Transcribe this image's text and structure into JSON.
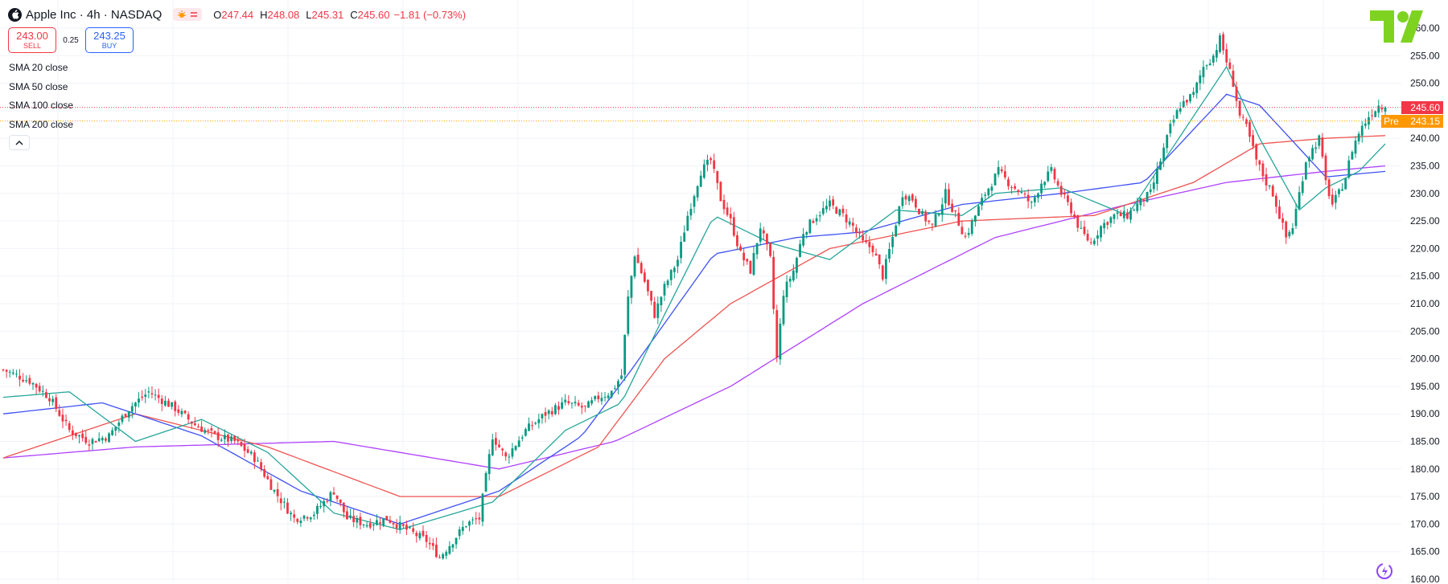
{
  "header": {
    "symbol_title": "Apple Inc · 4h · NASDAQ",
    "ohlc": {
      "open_label": "O",
      "open": "247.44",
      "high_label": "H",
      "high": "248.08",
      "low_label": "L",
      "low": "245.31",
      "close_label": "C",
      "close": "245.60",
      "change": "−1.81 (−0.73%)"
    },
    "colors": {
      "down": "#f23645",
      "up": "#089981"
    }
  },
  "trade": {
    "sell_price": "243.00",
    "sell_label": "SELL",
    "spread": "0.25",
    "buy_price": "243.25",
    "buy_label": "BUY"
  },
  "indicators": [
    "SMA 20 close",
    "SMA 50 close",
    "SMA 100 close",
    "SMA 200 close"
  ],
  "price_tags": {
    "last": "245.60",
    "pre_label": "Pre",
    "pre": "243.15"
  },
  "icons": [
    "apple-logo-icon",
    "sun-icon",
    "equals-icon",
    "chevron-up-icon",
    "tradingview-logo-icon",
    "assistant-icon"
  ],
  "chart_data": {
    "type": "candlestick",
    "ylim": [
      160,
      260
    ],
    "y_ticks": [
      "160.00",
      "165.00",
      "170.00",
      "175.00",
      "180.00",
      "185.00",
      "190.00",
      "195.00",
      "200.00",
      "205.00",
      "210.00",
      "215.00",
      "220.00",
      "225.00",
      "230.00",
      "235.00",
      "240.00",
      "245.00",
      "250.00",
      "255.00",
      "260.00"
    ],
    "grid": true,
    "series_colors": {
      "sma20": "#26a69a",
      "sma50": "#3f51f5",
      "sma100": "#ef5350",
      "sma200": "#b040ff"
    },
    "last_price": 245.6,
    "pre_price": 243.15,
    "close_path": [
      [
        0,
        198
      ],
      [
        8,
        196
      ],
      [
        14,
        193
      ],
      [
        20,
        187
      ],
      [
        26,
        185
      ],
      [
        32,
        186
      ],
      [
        38,
        191
      ],
      [
        44,
        194
      ],
      [
        52,
        191
      ],
      [
        58,
        188
      ],
      [
        64,
        186
      ],
      [
        70,
        185
      ],
      [
        76,
        182
      ],
      [
        82,
        176
      ],
      [
        88,
        171
      ],
      [
        94,
        172
      ],
      [
        100,
        176
      ],
      [
        104,
        171
      ],
      [
        110,
        170
      ],
      [
        116,
        171
      ],
      [
        122,
        169
      ],
      [
        128,
        167
      ],
      [
        132,
        164
      ],
      [
        136,
        167
      ],
      [
        140,
        170
      ],
      [
        144,
        171
      ],
      [
        148,
        186
      ],
      [
        152,
        182
      ],
      [
        158,
        187
      ],
      [
        164,
        190
      ],
      [
        170,
        192
      ],
      [
        176,
        191
      ],
      [
        180,
        193
      ],
      [
        184,
        194
      ],
      [
        187,
        197
      ],
      [
        189,
        211
      ],
      [
        191,
        219
      ],
      [
        194,
        214
      ],
      [
        197,
        208
      ],
      [
        200,
        213
      ],
      [
        204,
        218
      ],
      [
        207,
        226
      ],
      [
        211,
        234
      ],
      [
        214,
        236
      ],
      [
        217,
        229
      ],
      [
        220,
        225
      ],
      [
        223,
        219
      ],
      [
        226,
        216
      ],
      [
        229,
        224
      ],
      [
        232,
        218
      ],
      [
        234,
        200
      ],
      [
        236,
        212
      ],
      [
        239,
        216
      ],
      [
        242,
        223
      ],
      [
        246,
        226
      ],
      [
        250,
        228
      ],
      [
        254,
        226
      ],
      [
        257,
        224
      ],
      [
        260,
        221
      ],
      [
        263,
        220
      ],
      [
        266,
        215
      ],
      [
        269,
        222
      ],
      [
        272,
        230
      ],
      [
        275,
        229
      ],
      [
        278,
        226
      ],
      [
        281,
        224
      ],
      [
        285,
        230
      ],
      [
        288,
        226
      ],
      [
        291,
        222
      ],
      [
        294,
        226
      ],
      [
        297,
        230
      ],
      [
        301,
        234
      ],
      [
        304,
        232
      ],
      [
        308,
        230
      ],
      [
        311,
        228
      ],
      [
        314,
        232
      ],
      [
        317,
        234
      ],
      [
        320,
        230
      ],
      [
        323,
        227
      ],
      [
        326,
        223
      ],
      [
        329,
        221
      ],
      [
        332,
        224
      ],
      [
        336,
        226
      ],
      [
        340,
        226
      ],
      [
        343,
        228
      ],
      [
        347,
        230
      ],
      [
        350,
        236
      ],
      [
        353,
        242
      ],
      [
        356,
        246
      ],
      [
        360,
        248
      ],
      [
        363,
        253
      ],
      [
        366,
        255
      ],
      [
        368,
        258
      ],
      [
        370,
        254
      ],
      [
        372,
        250
      ],
      [
        374,
        244
      ],
      [
        376,
        242
      ],
      [
        379,
        236
      ],
      [
        382,
        232
      ],
      [
        384,
        230
      ],
      [
        386,
        226
      ],
      [
        388,
        222
      ],
      [
        390,
        224
      ],
      [
        392,
        230
      ],
      [
        394,
        236
      ],
      [
        396,
        238
      ],
      [
        398,
        240
      ],
      [
        400,
        232
      ],
      [
        402,
        228
      ],
      [
        404,
        230
      ],
      [
        406,
        233
      ],
      [
        408,
        238
      ],
      [
        410,
        241
      ],
      [
        413,
        244
      ],
      [
        416,
        246
      ],
      [
        418,
        245.6
      ]
    ],
    "sma20_path": [
      [
        0,
        193
      ],
      [
        20,
        194
      ],
      [
        40,
        185
      ],
      [
        60,
        189
      ],
      [
        80,
        183
      ],
      [
        100,
        172
      ],
      [
        120,
        169
      ],
      [
        148,
        174
      ],
      [
        170,
        187
      ],
      [
        187,
        192
      ],
      [
        200,
        208
      ],
      [
        215,
        226
      ],
      [
        232,
        221
      ],
      [
        250,
        218
      ],
      [
        270,
        227
      ],
      [
        290,
        226
      ],
      [
        300,
        230
      ],
      [
        320,
        231
      ],
      [
        340,
        226
      ],
      [
        360,
        244
      ],
      [
        370,
        253
      ],
      [
        380,
        240
      ],
      [
        392,
        227
      ],
      [
        400,
        231
      ],
      [
        410,
        234
      ],
      [
        418,
        239
      ]
    ],
    "sma50_path": [
      [
        0,
        190
      ],
      [
        30,
        192
      ],
      [
        60,
        186
      ],
      [
        90,
        176
      ],
      [
        120,
        170
      ],
      [
        150,
        176
      ],
      [
        175,
        186
      ],
      [
        190,
        198
      ],
      [
        215,
        219
      ],
      [
        240,
        222
      ],
      [
        260,
        223
      ],
      [
        290,
        228
      ],
      [
        320,
        230
      ],
      [
        345,
        232
      ],
      [
        370,
        248
      ],
      [
        380,
        246
      ],
      [
        400,
        233
      ],
      [
        418,
        234
      ]
    ],
    "sma100_path": [
      [
        0,
        182
      ],
      [
        40,
        190
      ],
      [
        80,
        184
      ],
      [
        120,
        175
      ],
      [
        150,
        175
      ],
      [
        180,
        184
      ],
      [
        200,
        200
      ],
      [
        220,
        210
      ],
      [
        250,
        220
      ],
      [
        290,
        225
      ],
      [
        330,
        226
      ],
      [
        360,
        232
      ],
      [
        380,
        239
      ],
      [
        400,
        240
      ],
      [
        418,
        240.5
      ]
    ],
    "sma200_path": [
      [
        0,
        182
      ],
      [
        40,
        184
      ],
      [
        100,
        185
      ],
      [
        150,
        180
      ],
      [
        185,
        185
      ],
      [
        220,
        195
      ],
      [
        260,
        210
      ],
      [
        300,
        222
      ],
      [
        340,
        228
      ],
      [
        370,
        232
      ],
      [
        400,
        234
      ],
      [
        418,
        235
      ]
    ]
  }
}
